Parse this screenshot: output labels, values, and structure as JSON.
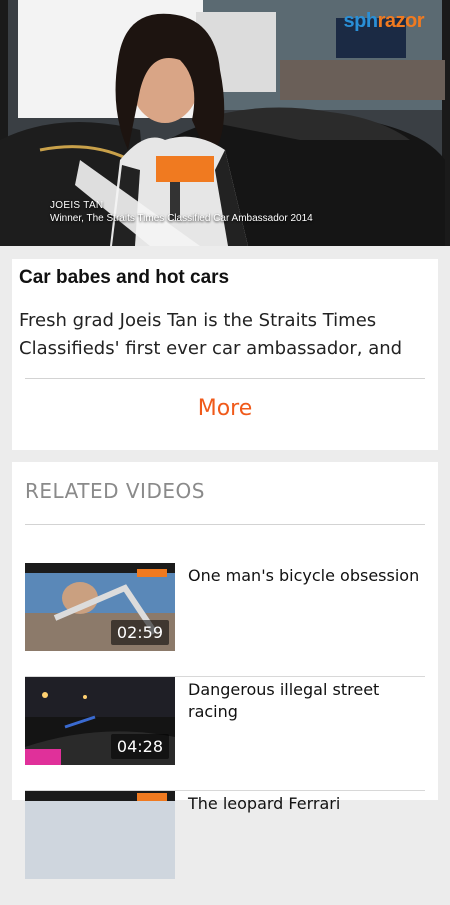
{
  "video": {
    "brand_left": "sph",
    "brand_right": "razor",
    "caption_name": "JOEIS TAN",
    "caption_role": "Winner, The Straits Times Classified Car Ambassador 2014"
  },
  "story": {
    "title": "Car babes and hot cars",
    "summary": "Fresh grad Joeis Tan is the Straits Times Classifieds' first ever car ambassador, and",
    "more_label": "More"
  },
  "related": {
    "heading": "RELATED VIDEOS",
    "items": [
      {
        "title": "One man's bicycle obsession",
        "duration": "02:59"
      },
      {
        "title": "Dangerous illegal street racing",
        "duration": "04:28"
      },
      {
        "title": "The leopard Ferrari",
        "duration": ""
      }
    ]
  },
  "colors": {
    "accent": "#f05a1a",
    "background": "#ececec",
    "card": "#ffffff",
    "heading_gray": "#8a8a8a",
    "brand_blue": "#2a8fd6",
    "brand_orange": "#f07a20"
  },
  "icons": [
    "play-video-thumbnail",
    "video-thumbnail"
  ]
}
